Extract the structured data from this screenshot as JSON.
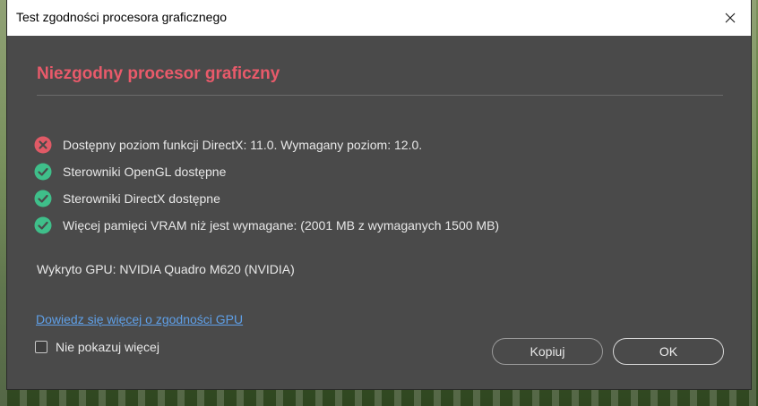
{
  "window": {
    "title": "Test zgodności procesora graficznego"
  },
  "heading": "Niezgodny procesor graficzny",
  "checks": [
    {
      "status": "fail",
      "icon": "error-circle-icon",
      "text": "Dostępny poziom funkcji DirectX: 11.0. Wymagany poziom: 12.0."
    },
    {
      "status": "pass",
      "icon": "check-circle-icon",
      "text": "Sterowniki OpenGL dostępne"
    },
    {
      "status": "pass",
      "icon": "check-circle-icon",
      "text": "Sterowniki DirectX dostępne"
    },
    {
      "status": "pass",
      "icon": "check-circle-icon",
      "text": "Więcej pamięci VRAM niż jest wymagane: (2001 MB z wymaganych 1500 MB)"
    }
  ],
  "gpu_detected": "Wykryto GPU: NVIDIA Quadro M620 (NVIDIA)",
  "learn_more_link": "Dowiedz się więcej o zgodności GPU",
  "dont_show_again": {
    "label": "Nie pokazuj więcej",
    "checked": false
  },
  "buttons": {
    "copy": "Kopiuj",
    "ok": "OK"
  },
  "colors": {
    "heading": "#e85a6a",
    "fail": "#e05a66",
    "pass": "#3fbf8a",
    "link": "#5fa0e8",
    "dialog_bg": "#4a4a4a"
  }
}
